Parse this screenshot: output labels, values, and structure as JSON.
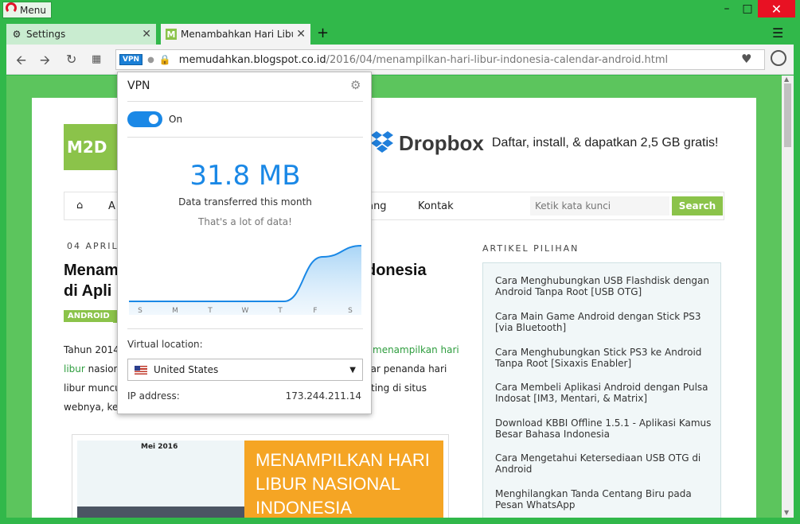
{
  "window": {
    "menu_label": "Menu"
  },
  "tabs": [
    {
      "title": "Settings"
    },
    {
      "title": "Menambahkan Hari Libur Nas"
    }
  ],
  "address": {
    "vpn_badge": "VPN",
    "domain": "memudahkan.blogspot.co.id",
    "path": "/2016/04/menampilkan-hari-libur-indonesia-calendar-android.html"
  },
  "site": {
    "logo_text": "M2D",
    "dropbox_name": "Dropbox",
    "dropbox_text": "Daftar, install, & dapatkan 2,5 GB gratis!",
    "menu": {
      "item_a": "A",
      "tentang": "tang",
      "kontak": "Kontak"
    },
    "search_placeholder": "Ketik kata kunci",
    "search_button": "Search",
    "post_date": "04 APRIL",
    "post_title_left_1": "Menam",
    "post_title_right_1": "donesia",
    "post_title_left_2": "di Apli",
    "tag": "ANDROID",
    "body": {
      "l1_left": "Tahun 2014",
      "l1_link": "menampilkan hari",
      "l2_link": "libur",
      "l2_left": " nasion",
      "l2_right": "gar penanda hari",
      "l3_left": "libur muncu",
      "l3_right": "ting di situs",
      "l4_left": "webnya, ke"
    },
    "image": {
      "month": "Mei 2016",
      "text": "MENAMPILKAN HARI LIBUR NASIONAL INDONESIA"
    },
    "sidebar": {
      "title": "ARTIKEL PILIHAN",
      "items": [
        "Cara Menghubungkan USB Flashdisk dengan Android Tanpa Root [USB OTG]",
        "Cara Main Game Android dengan Stick PS3 [via Bluetooth]",
        "Cara Menghubungkan Stick PS3 ke Android Tanpa Root [Sixaxis Enabler]",
        "Cara Membeli Aplikasi Android dengan Pulsa Indosat [IM3, Mentari, & Matrix]",
        "Download KBBI Offline 1.5.1 - Aplikasi Kamus Besar Bahasa Indonesia",
        "Cara Mengetahui Ketersediaan USB OTG di Android",
        "Menghilangkan Tanda Centang Biru pada Pesan WhatsApp"
      ]
    }
  },
  "vpn": {
    "title": "VPN",
    "toggle_label": "On",
    "amount": "31.8 MB",
    "subtitle": "Data transferred this month",
    "note": "That's a lot of data!",
    "days": [
      "S",
      "M",
      "T",
      "W",
      "T",
      "F",
      "S"
    ],
    "usage_levels": [
      0,
      0,
      0,
      0,
      0,
      0.8,
      1.0
    ],
    "location_label": "Virtual location:",
    "location_value": "United States",
    "ip_label": "IP address:",
    "ip_value": "173.244.211.14",
    "accent_color": "#1a88e6"
  }
}
